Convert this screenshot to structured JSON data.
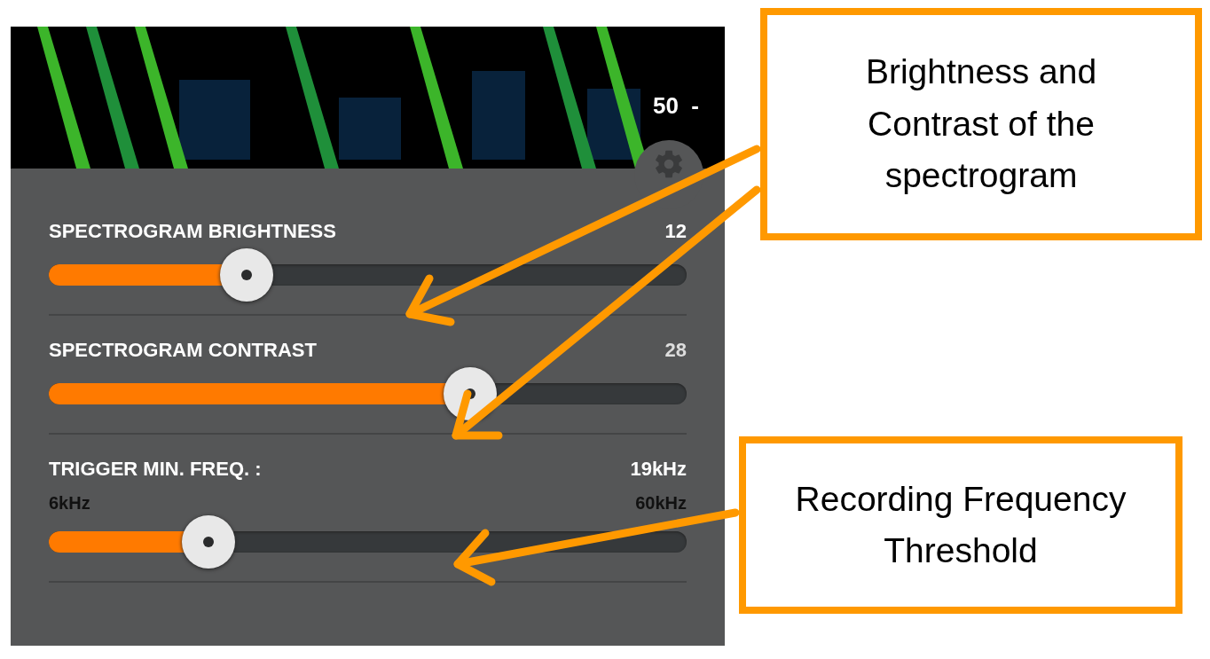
{
  "spectrogram": {
    "scale_label": "50  -"
  },
  "settings": [
    {
      "kind": "slider",
      "label": "SPECTROGRAM BRIGHTNESS",
      "reading": "12",
      "level": 0.31
    },
    {
      "kind": "slider",
      "label": "SPECTROGRAM CONTRAST",
      "reading": "28",
      "level": 0.66
    },
    {
      "kind": "range_slider",
      "label": "TRIGGER MIN. FREQ. :",
      "reading": "19kHz",
      "min_label": "6kHz",
      "max_label": "60kHz",
      "level": 0.25
    }
  ],
  "callouts": [
    {
      "text": "Brightness and Contrast of the spectrogram"
    },
    {
      "text": "Recording Frequency Threshold"
    }
  ]
}
